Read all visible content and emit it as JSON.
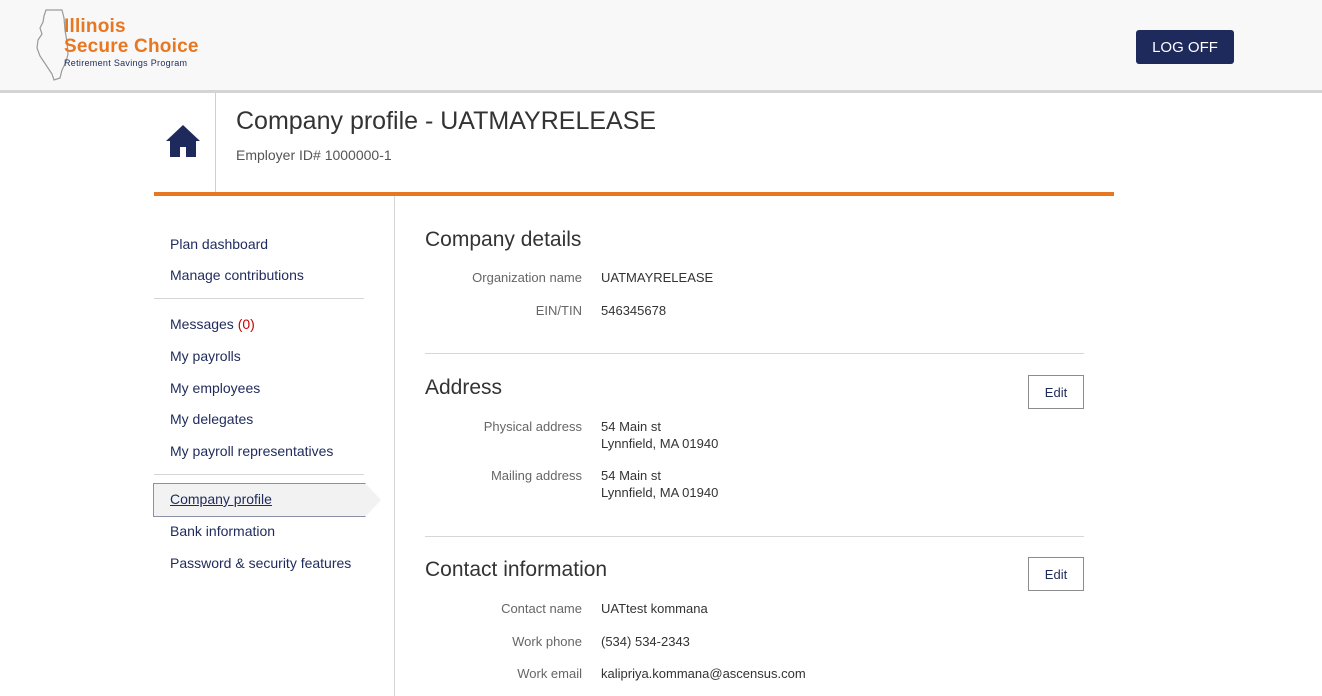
{
  "brand": {
    "line1": "Illinois",
    "line2": "Secure Choice",
    "tagline": "Retirement Savings Program"
  },
  "header": {
    "logoff_label": "LOG OFF"
  },
  "page": {
    "title": "Company profile - UATMAYRELEASE",
    "subtitle": "Employer ID# 1000000-1"
  },
  "sidebar": {
    "group1": [
      {
        "label": "Plan dashboard"
      },
      {
        "label": "Manage contributions"
      }
    ],
    "messages": {
      "label": "Messages",
      "count": "(0)"
    },
    "group2": [
      {
        "label": "My payrolls"
      },
      {
        "label": "My employees"
      },
      {
        "label": "My delegates"
      },
      {
        "label": "My payroll representatives"
      }
    ],
    "group3": [
      {
        "label": "Company profile",
        "active": true
      },
      {
        "label": "Bank information"
      },
      {
        "label": "Password & security features"
      }
    ]
  },
  "company_details": {
    "title": "Company details",
    "org_name_label": "Organization name",
    "org_name_value": "UATMAYRELEASE",
    "ein_label": "EIN/TIN",
    "ein_value": "546345678"
  },
  "address": {
    "title": "Address",
    "edit_label": "Edit",
    "physical_label": "Physical address",
    "physical_line1": "54 Main st",
    "physical_line2": "Lynnfield, MA 01940",
    "mailing_label": "Mailing address",
    "mailing_line1": "54 Main st",
    "mailing_line2": "Lynnfield, MA 01940"
  },
  "contact": {
    "title": "Contact information",
    "edit_label": "Edit",
    "name_label": "Contact name",
    "name_value": "UATtest kommana",
    "phone_label": "Work phone",
    "phone_value": "(534) 534-2343",
    "email_label": "Work email",
    "email_value": "kalipriya.kommana@ascensus.com"
  },
  "colors": {
    "accent_orange": "#e87722",
    "navy": "#1f2a5c",
    "alert_red": "#cc0000"
  }
}
